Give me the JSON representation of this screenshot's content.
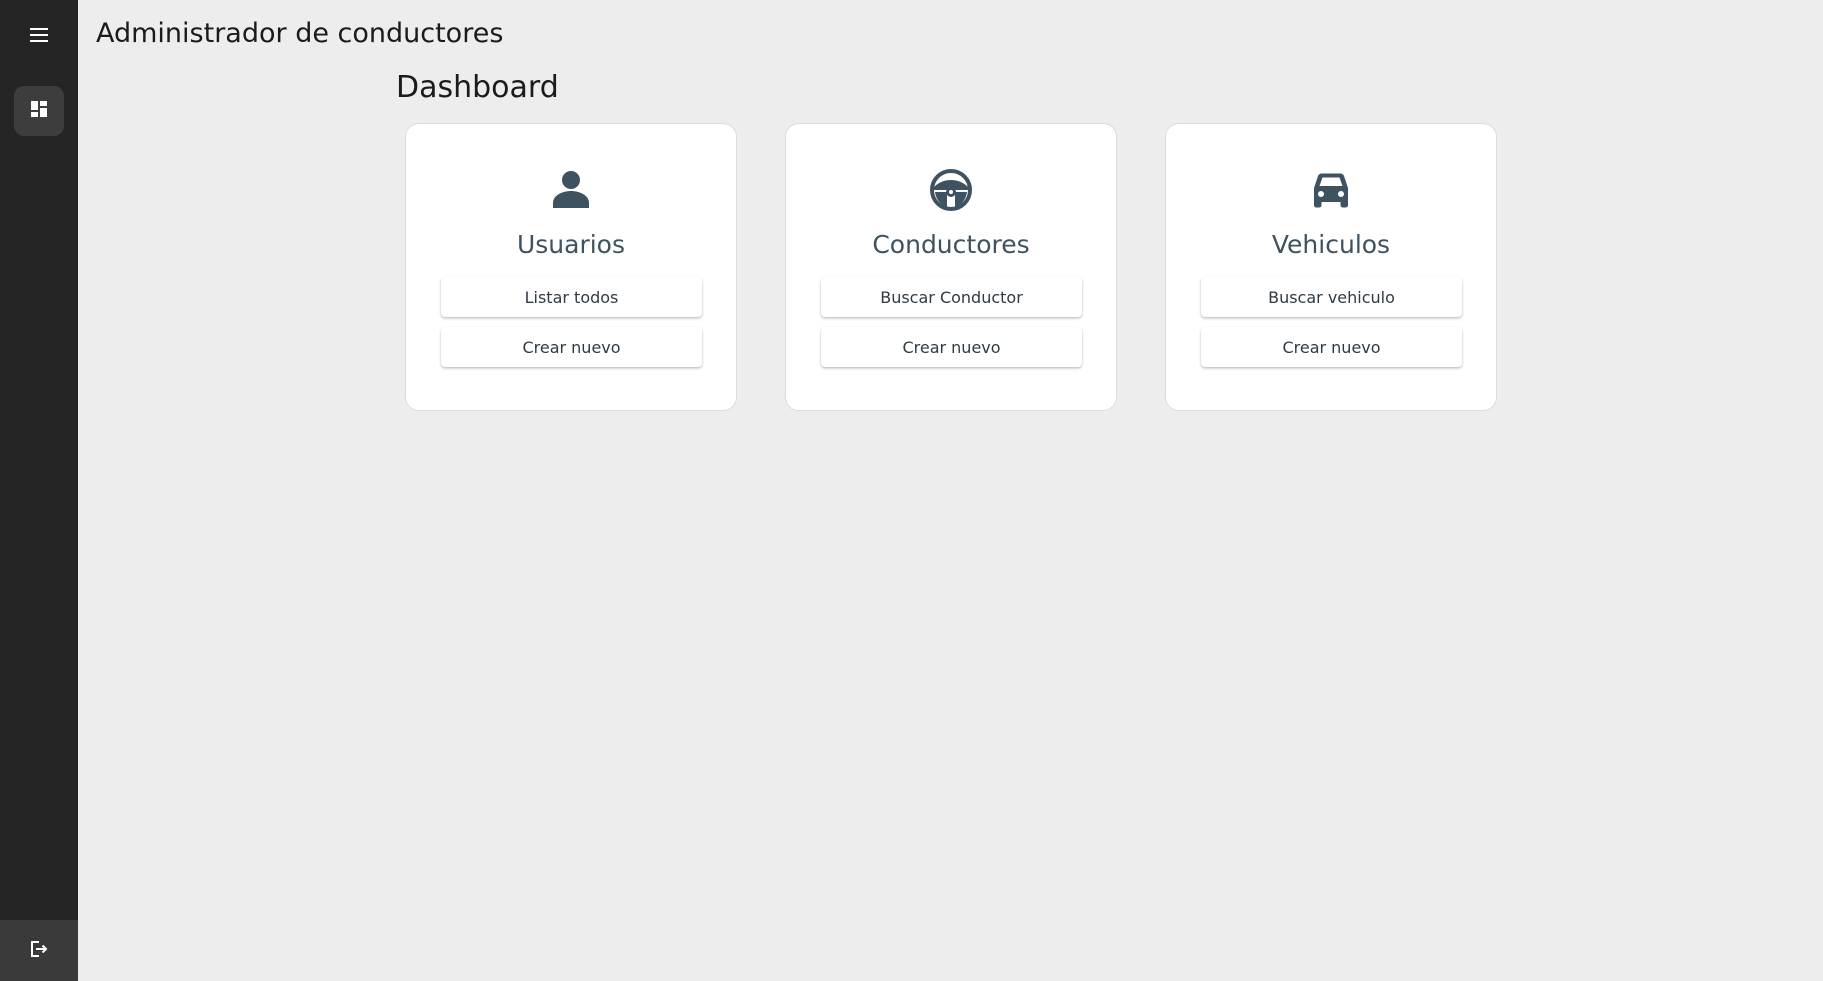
{
  "header": {
    "app_title": "Administrador de conductores"
  },
  "sidebar": {
    "menu_icon": "hamburger-menu-icon",
    "dashboard_icon": "dashboard-icon",
    "logout_icon": "logout-icon"
  },
  "main": {
    "page_title": "Dashboard",
    "cards": [
      {
        "icon": "person-icon",
        "title": "Usuarios",
        "buttons": [
          "Listar todos",
          "Crear nuevo"
        ]
      },
      {
        "icon": "steering-wheel-icon",
        "title": "Conductores",
        "buttons": [
          "Buscar Conductor",
          "Crear nuevo"
        ]
      },
      {
        "icon": "car-icon",
        "title": "Vehiculos",
        "buttons": [
          "Buscar vehiculo",
          "Crear nuevo"
        ]
      }
    ]
  },
  "colors": {
    "background": "#ededed",
    "sidebar": "#252525",
    "sidebar_active": "#3d3d3d",
    "icon": "#3e5260",
    "card": "#ffffff"
  }
}
